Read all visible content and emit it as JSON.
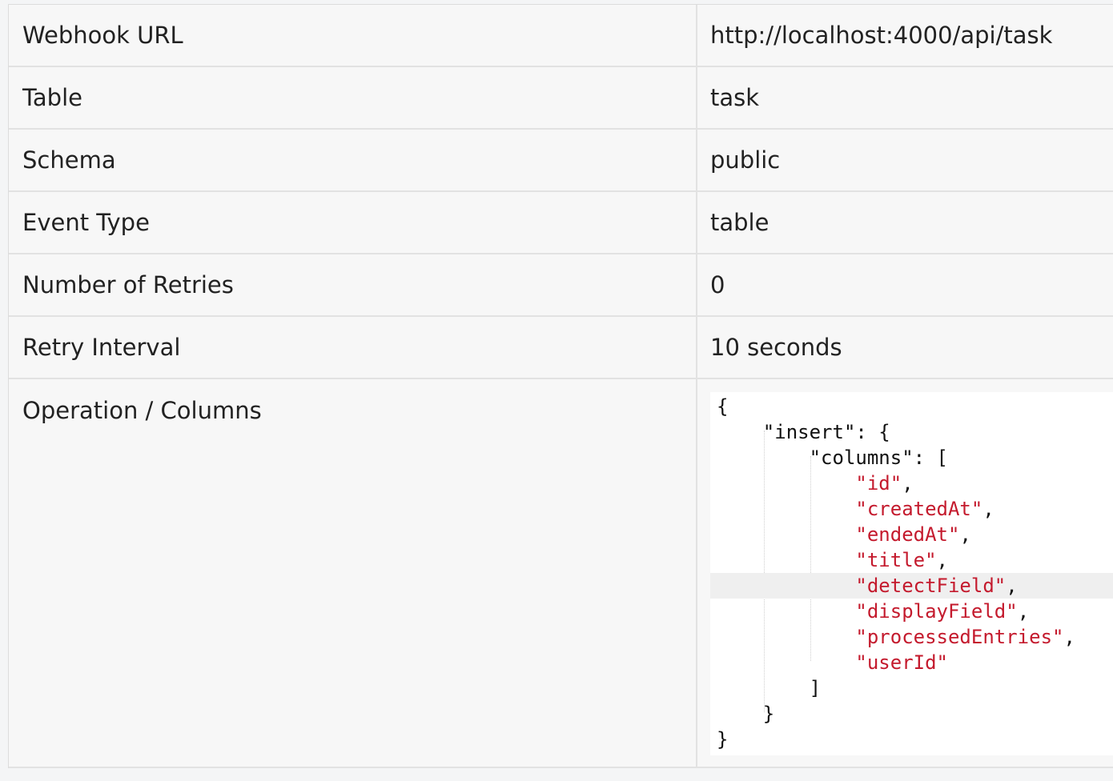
{
  "rows": [
    {
      "label": "Webhook URL",
      "value": "http://localhost:4000/api/task"
    },
    {
      "label": "Table",
      "value": "task"
    },
    {
      "label": "Schema",
      "value": "public"
    },
    {
      "label": "Event Type",
      "value": "table"
    },
    {
      "label": "Number of Retries",
      "value": "0"
    },
    {
      "label": "Retry Interval",
      "value": "10 seconds"
    }
  ],
  "operations": {
    "label": "Operation / Columns",
    "code": {
      "open_brace": "{",
      "insert_key": "\"insert\": {",
      "columns_key": "\"columns\": [",
      "columns": [
        "\"id\"",
        "\"createdAt\"",
        "\"endedAt\"",
        "\"title\"",
        "\"detectField\"",
        "\"displayField\"",
        "\"processedEntries\"",
        "\"userId\""
      ],
      "close_bracket": "]",
      "close_inner": "}",
      "close_outer": "}"
    }
  },
  "colors": {
    "string": "#c41a2d",
    "text": "#222222",
    "border": "#e2e2e2"
  }
}
